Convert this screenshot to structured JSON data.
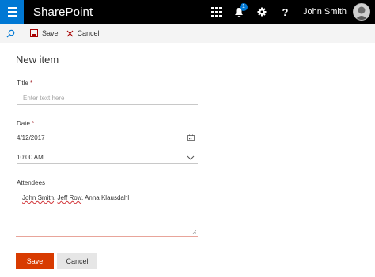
{
  "suite_bar": {
    "brand": "SharePoint",
    "notification_count": "1",
    "help_label": "?",
    "user_name": "John Smith"
  },
  "command_bar": {
    "save_label": "Save",
    "cancel_label": "Cancel"
  },
  "form": {
    "title": "New item",
    "title_field": {
      "label": "Title",
      "required_mark": "*",
      "placeholder": "Enter text here",
      "value": ""
    },
    "date_field": {
      "label": "Date",
      "required_mark": "*",
      "date_value": "4/12/2017",
      "time_value": "10:00 AM"
    },
    "attendees_field": {
      "label": "Attendees",
      "names": [
        "John Smith",
        "Jeff Row",
        "Anna Klausdahl"
      ],
      "separator": ", "
    },
    "save_label": "Save",
    "cancel_label": "Cancel"
  },
  "colors": {
    "suite_bar_bg": "#000000",
    "brand_accent": "#0078d4",
    "primary_button": "#d83b01",
    "required": "#a4262c"
  }
}
